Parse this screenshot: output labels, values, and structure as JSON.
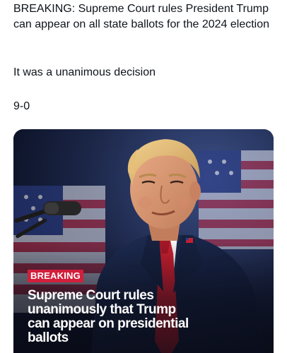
{
  "post": {
    "headline": "BREAKING: Supreme Court rules President Trump can appear on all state ballots for the 2024 election",
    "subtext": "It was a unanimous decision",
    "score": "9-0"
  },
  "media_card": {
    "badge": "BREAKING",
    "headline": "Supreme Court rules unanimously that Trump can appear on presidential ballots",
    "badge_color": "#d21f3c",
    "text_color": "#ffffff"
  }
}
